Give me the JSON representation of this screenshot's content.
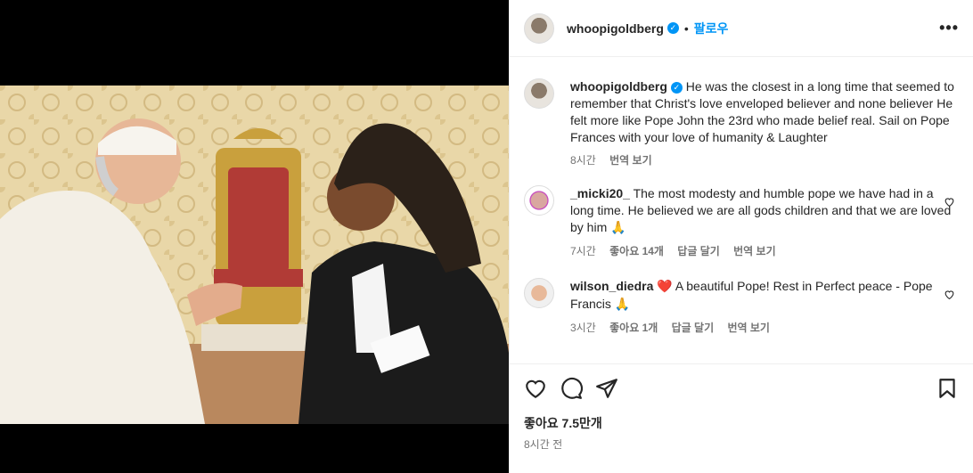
{
  "post": {
    "username": "whoopigoldberg",
    "verified_icon": "verified-badge-icon",
    "follow_label": "팔로우",
    "more_icon": "more-options-icon"
  },
  "caption": {
    "username": "whoopigoldberg",
    "text": "He was the closest in a long time that seemed to remember that Christ's love enveloped believer and none believer  He felt more like Pope John the 23rd who made belief real. Sail on Pope Frances with your love of humanity & Laughter",
    "time": "8시간",
    "translate_label": "번역 보기"
  },
  "comments": [
    {
      "username": "_micki20_",
      "text": "The most modesty and humble pope we have had in a long time. He believed we are all gods children and that we are loved by him",
      "emoji": "🙏",
      "time": "7시간",
      "likes_label": "좋아요 14개",
      "reply_label": "답글 달기",
      "translate_label": "번역 보기"
    },
    {
      "username": "wilson_diedra",
      "heart": "❤️",
      "text": "A beautiful Pope! Rest in Perfect peace - Pope Francis",
      "emoji": "🙏",
      "time": "3시간",
      "likes_label": "좋아요 1개",
      "reply_label": "답글 달기",
      "translate_label": "번역 보기"
    }
  ],
  "actions": {
    "likes_label": "좋아요 7.5만개",
    "posted_ago": "8시간 전"
  },
  "colors": {
    "accent": "#0095f6",
    "text": "#262626",
    "muted": "#737373",
    "heart": "#ed4956"
  }
}
